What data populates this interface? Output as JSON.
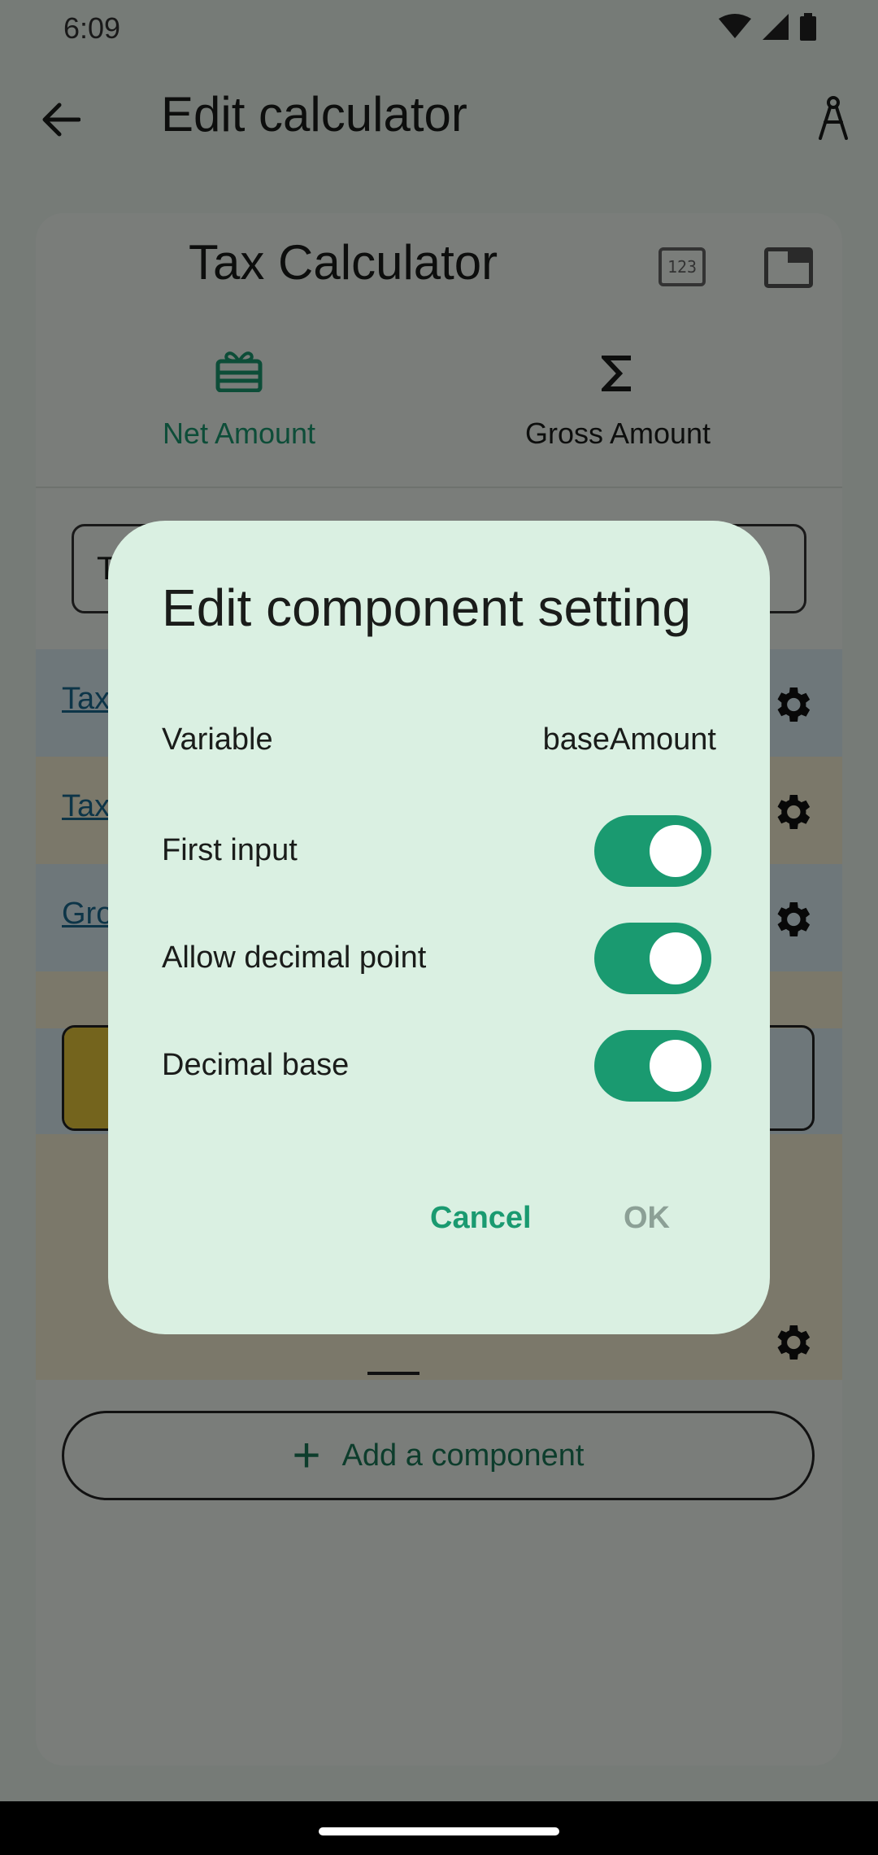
{
  "status_bar": {
    "time": "6:09"
  },
  "app_bar": {
    "title": "Edit calculator"
  },
  "card": {
    "title": "Tax Calculator",
    "icon_123_text": "123",
    "tabs": [
      {
        "label": "Net Amount",
        "selected": true
      },
      {
        "label": "Gross Amount",
        "selected": false
      }
    ],
    "input_prefix": "T",
    "rows": [
      {
        "label": "Tax"
      },
      {
        "label": "Tax"
      },
      {
        "label": "Gro"
      }
    ],
    "add_component_label": "Add a component"
  },
  "dialog": {
    "title": "Edit component setting",
    "variable_label": "Variable",
    "variable_value": "baseAmount",
    "settings": [
      {
        "label": "First input",
        "on": true
      },
      {
        "label": "Allow decimal point",
        "on": true
      },
      {
        "label": "Decimal base",
        "on": true
      }
    ],
    "cancel_label": "Cancel",
    "ok_label": "OK"
  },
  "colors": {
    "accent": "#1a9a70",
    "dialog_bg": "#daf0e2",
    "scrim": "rgba(0,0,0,0.5)"
  }
}
